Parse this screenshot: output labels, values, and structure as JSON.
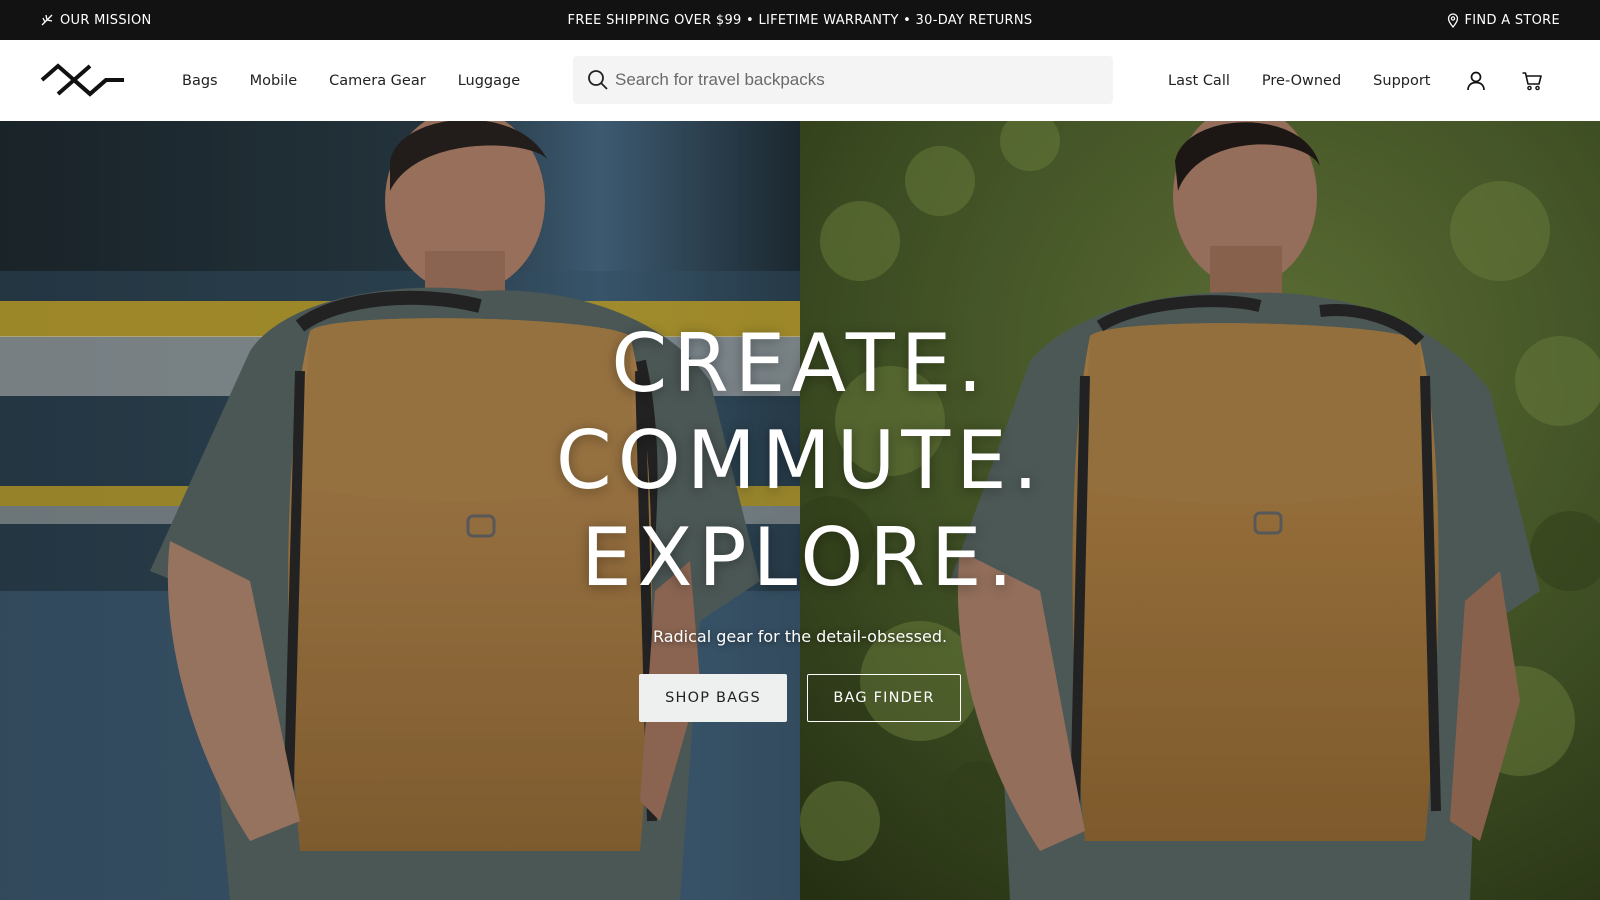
{
  "announcement": {
    "left_label": "OUR MISSION",
    "center_text": "FREE SHIPPING OVER $99 • LIFETIME WARRANTY • 30-DAY RETURNS",
    "right_label": "FIND A STORE"
  },
  "header": {
    "nav_left": [
      "Bags",
      "Mobile",
      "Camera Gear",
      "Luggage"
    ],
    "search": {
      "placeholder": "Search for travel backpacks"
    },
    "nav_right": [
      "Last Call",
      "Pre-Owned",
      "Support"
    ]
  },
  "hero": {
    "headline": [
      "CREATE.",
      "COMMUTE.",
      "EXPLORE."
    ],
    "subhead": "Radical gear for the detail-obsessed.",
    "primary_button": "SHOP BAGS",
    "secondary_button": "BAG FINDER"
  },
  "colors": {
    "announcement_bg": "#121212",
    "header_bg": "#ffffff",
    "search_bg": "#f4f4f4",
    "backpack_tan": "#b0834a",
    "shirt_gray": "#5c6b68",
    "foliage_green": "#4a5d2a",
    "transit_blue": "#4a6e8a",
    "stripe_yellow": "#d9b62c"
  }
}
